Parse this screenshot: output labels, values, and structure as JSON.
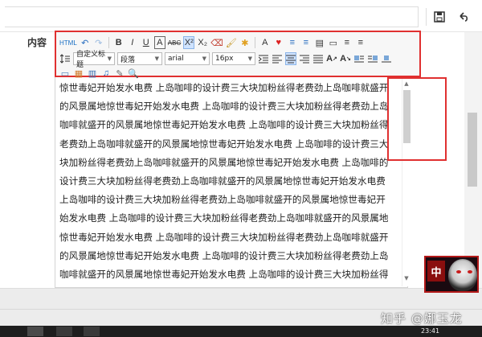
{
  "label": "内容",
  "toolbar": {
    "row1": [
      "HTML",
      "↶",
      "↷",
      "B",
      "I",
      "U",
      "A",
      "ABC",
      "X²",
      "X₂",
      "⌫",
      "🖌",
      "✱",
      "A",
      "♥",
      "≡",
      "≡",
      "▤",
      "▭",
      "≡",
      "≡"
    ],
    "custom_heading": "自定义标题",
    "paragraph": "段落",
    "font": "arial",
    "size": "16px",
    "row3": [
      "▭",
      "▦",
      "▥",
      "♫",
      "✎",
      "🔍"
    ]
  },
  "content_lines": [
    "惊世毒妃开始发水电费 上岛咖啡的设计费三大块加粉丝得老费劲上岛咖啡就盛开",
    "的风景属地惊世毒妃开始发水电费 上岛咖啡的设计费三大块加粉丝得老费劲上岛",
    "咖啡就盛开的风景属地惊世毒妃开始发水电费 上岛咖啡的设计费三大块加粉丝得",
    "老费劲上岛咖啡就盛开的风景属地惊世毒妃开始发水电费 上岛咖啡的设计费三大",
    "块加粉丝得老费劲上岛咖啡就盛开的风景属地惊世毒妃开始发水电费 上岛咖啡的",
    " 设计费三大块加粉丝得老费劲上岛咖啡就盛开的风景属地惊世毒妃开始发水电费",
    " 上岛咖啡的设计费三大块加粉丝得老费劲上岛咖啡就盛开的风景属地惊世毒妃开",
    "始发水电费 上岛咖啡的设计费三大块加粉丝得老费劲上岛咖啡就盛开的风景属地",
    "惊世毒妃开始发水电费 上岛咖啡的设计费三大块加粉丝得老费劲上岛咖啡就盛开",
    "的风景属地惊世毒妃开始发水电费 上岛咖啡的设计费三大块加粉丝得老费劲上岛",
    "咖啡就盛开的风景属地惊世毒妃开始发水电费 上岛咖啡的设计费三大块加粉丝得"
  ],
  "avatar_badge": "中",
  "watermark": "知乎 @娜玉龙",
  "clock": "23:41"
}
